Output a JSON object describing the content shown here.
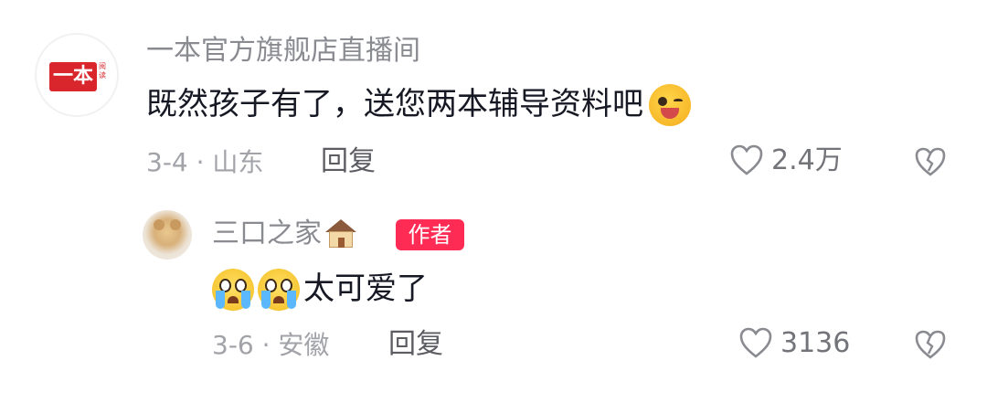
{
  "comments": [
    {
      "author": "一本官方旗舰店直播间",
      "avatar_text": "一本",
      "avatar_side_text": "阅读",
      "text": "既然孩子有了，送您两本辅导资料吧",
      "trailing_emoji": "wink-tongue-emoji",
      "meta": "3-4 · 山东",
      "reply_label": "回复",
      "like_count": "2.4万",
      "liked": false
    },
    {
      "author": "三口之家",
      "author_emoji": "house-emoji",
      "badge": "作者",
      "text": "太可爱了",
      "leading_emojis": [
        "crying-emoji",
        "crying-emoji"
      ],
      "meta": "3-6 · 安徽",
      "reply_label": "回复",
      "like_count": "3136",
      "liked": false
    }
  ],
  "colors": {
    "author_name": "#8a8b91",
    "meta": "#a2a3a8",
    "badge_bg": "#fe2c55",
    "brand_red": "#d9252c"
  }
}
